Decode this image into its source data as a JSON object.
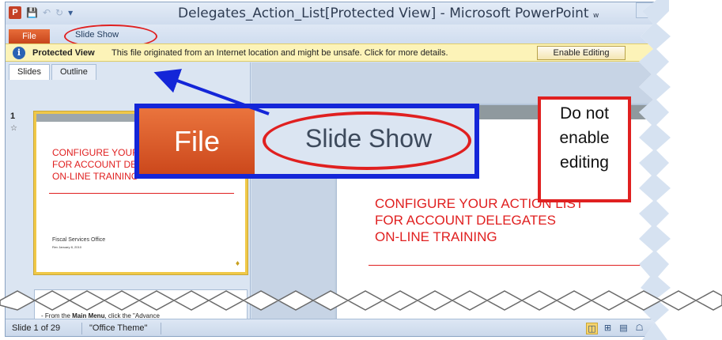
{
  "window": {
    "title": "Delegates_Action_List[Protected View] - Microsoft PowerPoint",
    "title_suffix": "w",
    "app_icon": "P",
    "quick_access": {
      "save_icon": "save-icon",
      "undo_icon": "undo-icon",
      "redo_icon": "redo-icon",
      "customize_icon": "customize-qat-icon"
    },
    "controls": {
      "minimize": "–",
      "maximize": "□",
      "close": "X"
    }
  },
  "ribbon": {
    "file_tab": "File",
    "slideshow_tab": "Slide Show",
    "minimize_ribbon_glyph": "∇",
    "help_glyph": "?"
  },
  "message_bar": {
    "icon_glyph": "i",
    "label": "Protected View",
    "message": "This file originated from an Internet location and might be unsafe. Click for more details.",
    "button": "Enable Editing",
    "close": "×"
  },
  "left_panel": {
    "tabs": [
      "Slides",
      "Outline"
    ],
    "close": "×",
    "slide_number": "1",
    "thumb1": {
      "title": "CONFIGURE YOUR ACTION LIST\nFOR ACCOUNT DELEGATES\nON-LINE TRAINING",
      "subtitle": "Fiscal Services  Office",
      "date": "Rev January 8, 2010"
    },
    "thumb2": {
      "text_prefix": "- From the ",
      "text_bold": "Main Menu",
      "text_suffix": ", click the \"Advance"
    }
  },
  "main_slide": {
    "title": "CONFIGURE YOUR ACTION LIST\nFOR ACCOUNT DELEGATES\nON-LINE TRAINING"
  },
  "status_bar": {
    "slide_info": "Slide 1 of 29",
    "theme": "\"Office Theme\"",
    "view_normal": "◫",
    "view_sorter": "⊞",
    "view_reading": "▤",
    "view_slideshow": "☖",
    "zoom_in": "+",
    "fit": "⤢"
  },
  "annotations": {
    "callout_file": "File",
    "callout_slideshow": "Slide Show",
    "note": "Do not\nenable\nediting"
  },
  "colors": {
    "accent_red": "#e02020",
    "callout_blue": "#1426d8",
    "file_orange": "#cc481c",
    "message_bar_yellow": "#fcf3b8"
  }
}
